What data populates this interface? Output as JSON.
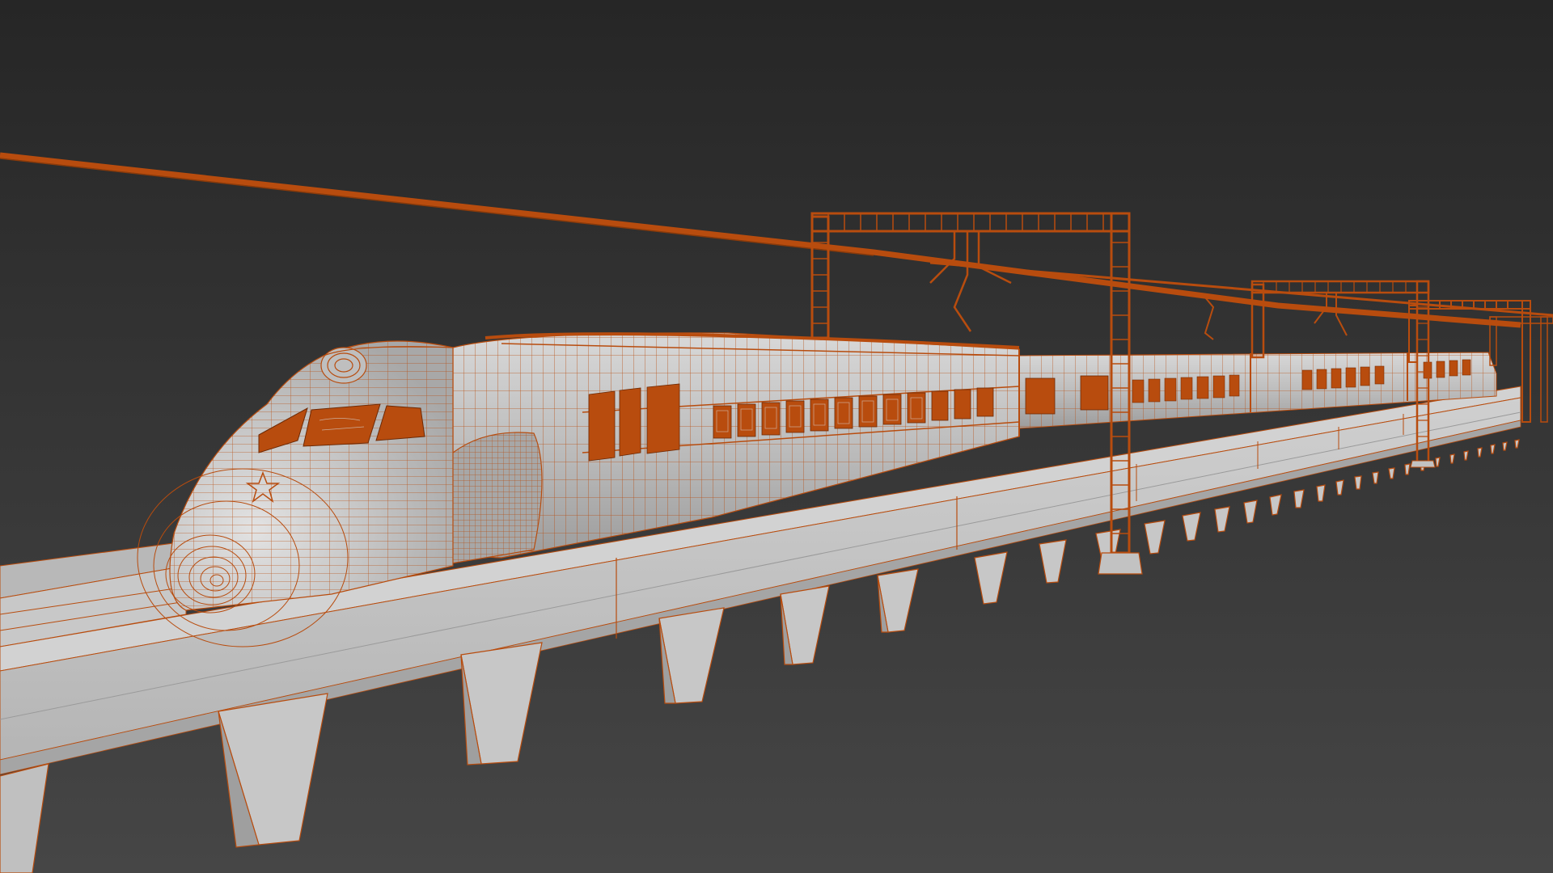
{
  "viewport": {
    "kind": "3d-viewport",
    "render_mode": "shaded-with-wireframe"
  },
  "scene": {
    "subject": "high-speed-train-on-elevated-viaduct",
    "colors": {
      "background_top": "#262626",
      "background_bottom": "#464646",
      "wireframe": "#b84c0e",
      "surface_light": "#c6c6c6",
      "surface_mid": "#a9a9a9",
      "surface_dark": "#8f8f8f"
    }
  }
}
